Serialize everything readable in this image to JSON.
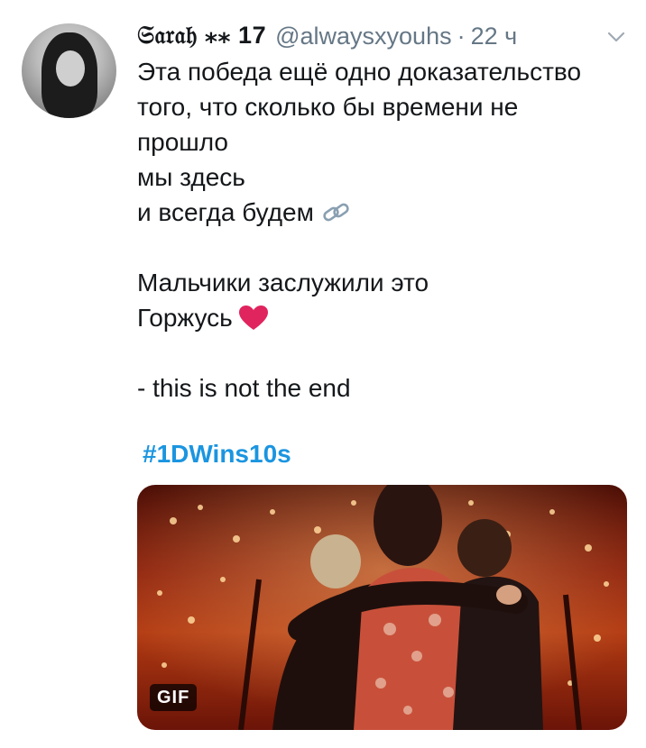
{
  "tweet": {
    "display_name": "𝔖𝔞𝔯𝔞𝔥 ⁎⁎ 17",
    "handle": "@alwaysxyouhs",
    "separator": "·",
    "timestamp": "22 ч",
    "lines": [
      "Эта победа ещё одно доказательство",
      "того, что сколько бы времени не",
      "прошло",
      "мы здесь",
      "и всегда будем",
      "",
      "Мальчики заслужили это",
      "Горжусь",
      "",
      "- this is not the end"
    ],
    "hashtag": "#1DWins10s",
    "media_badge": "GIF"
  },
  "icons": {
    "more": "chevron-down-icon",
    "link": "link-icon",
    "heart": "heart-icon"
  },
  "colors": {
    "link": "#1b95e0",
    "secondary_text": "#657786",
    "heart": "#e0245e"
  }
}
